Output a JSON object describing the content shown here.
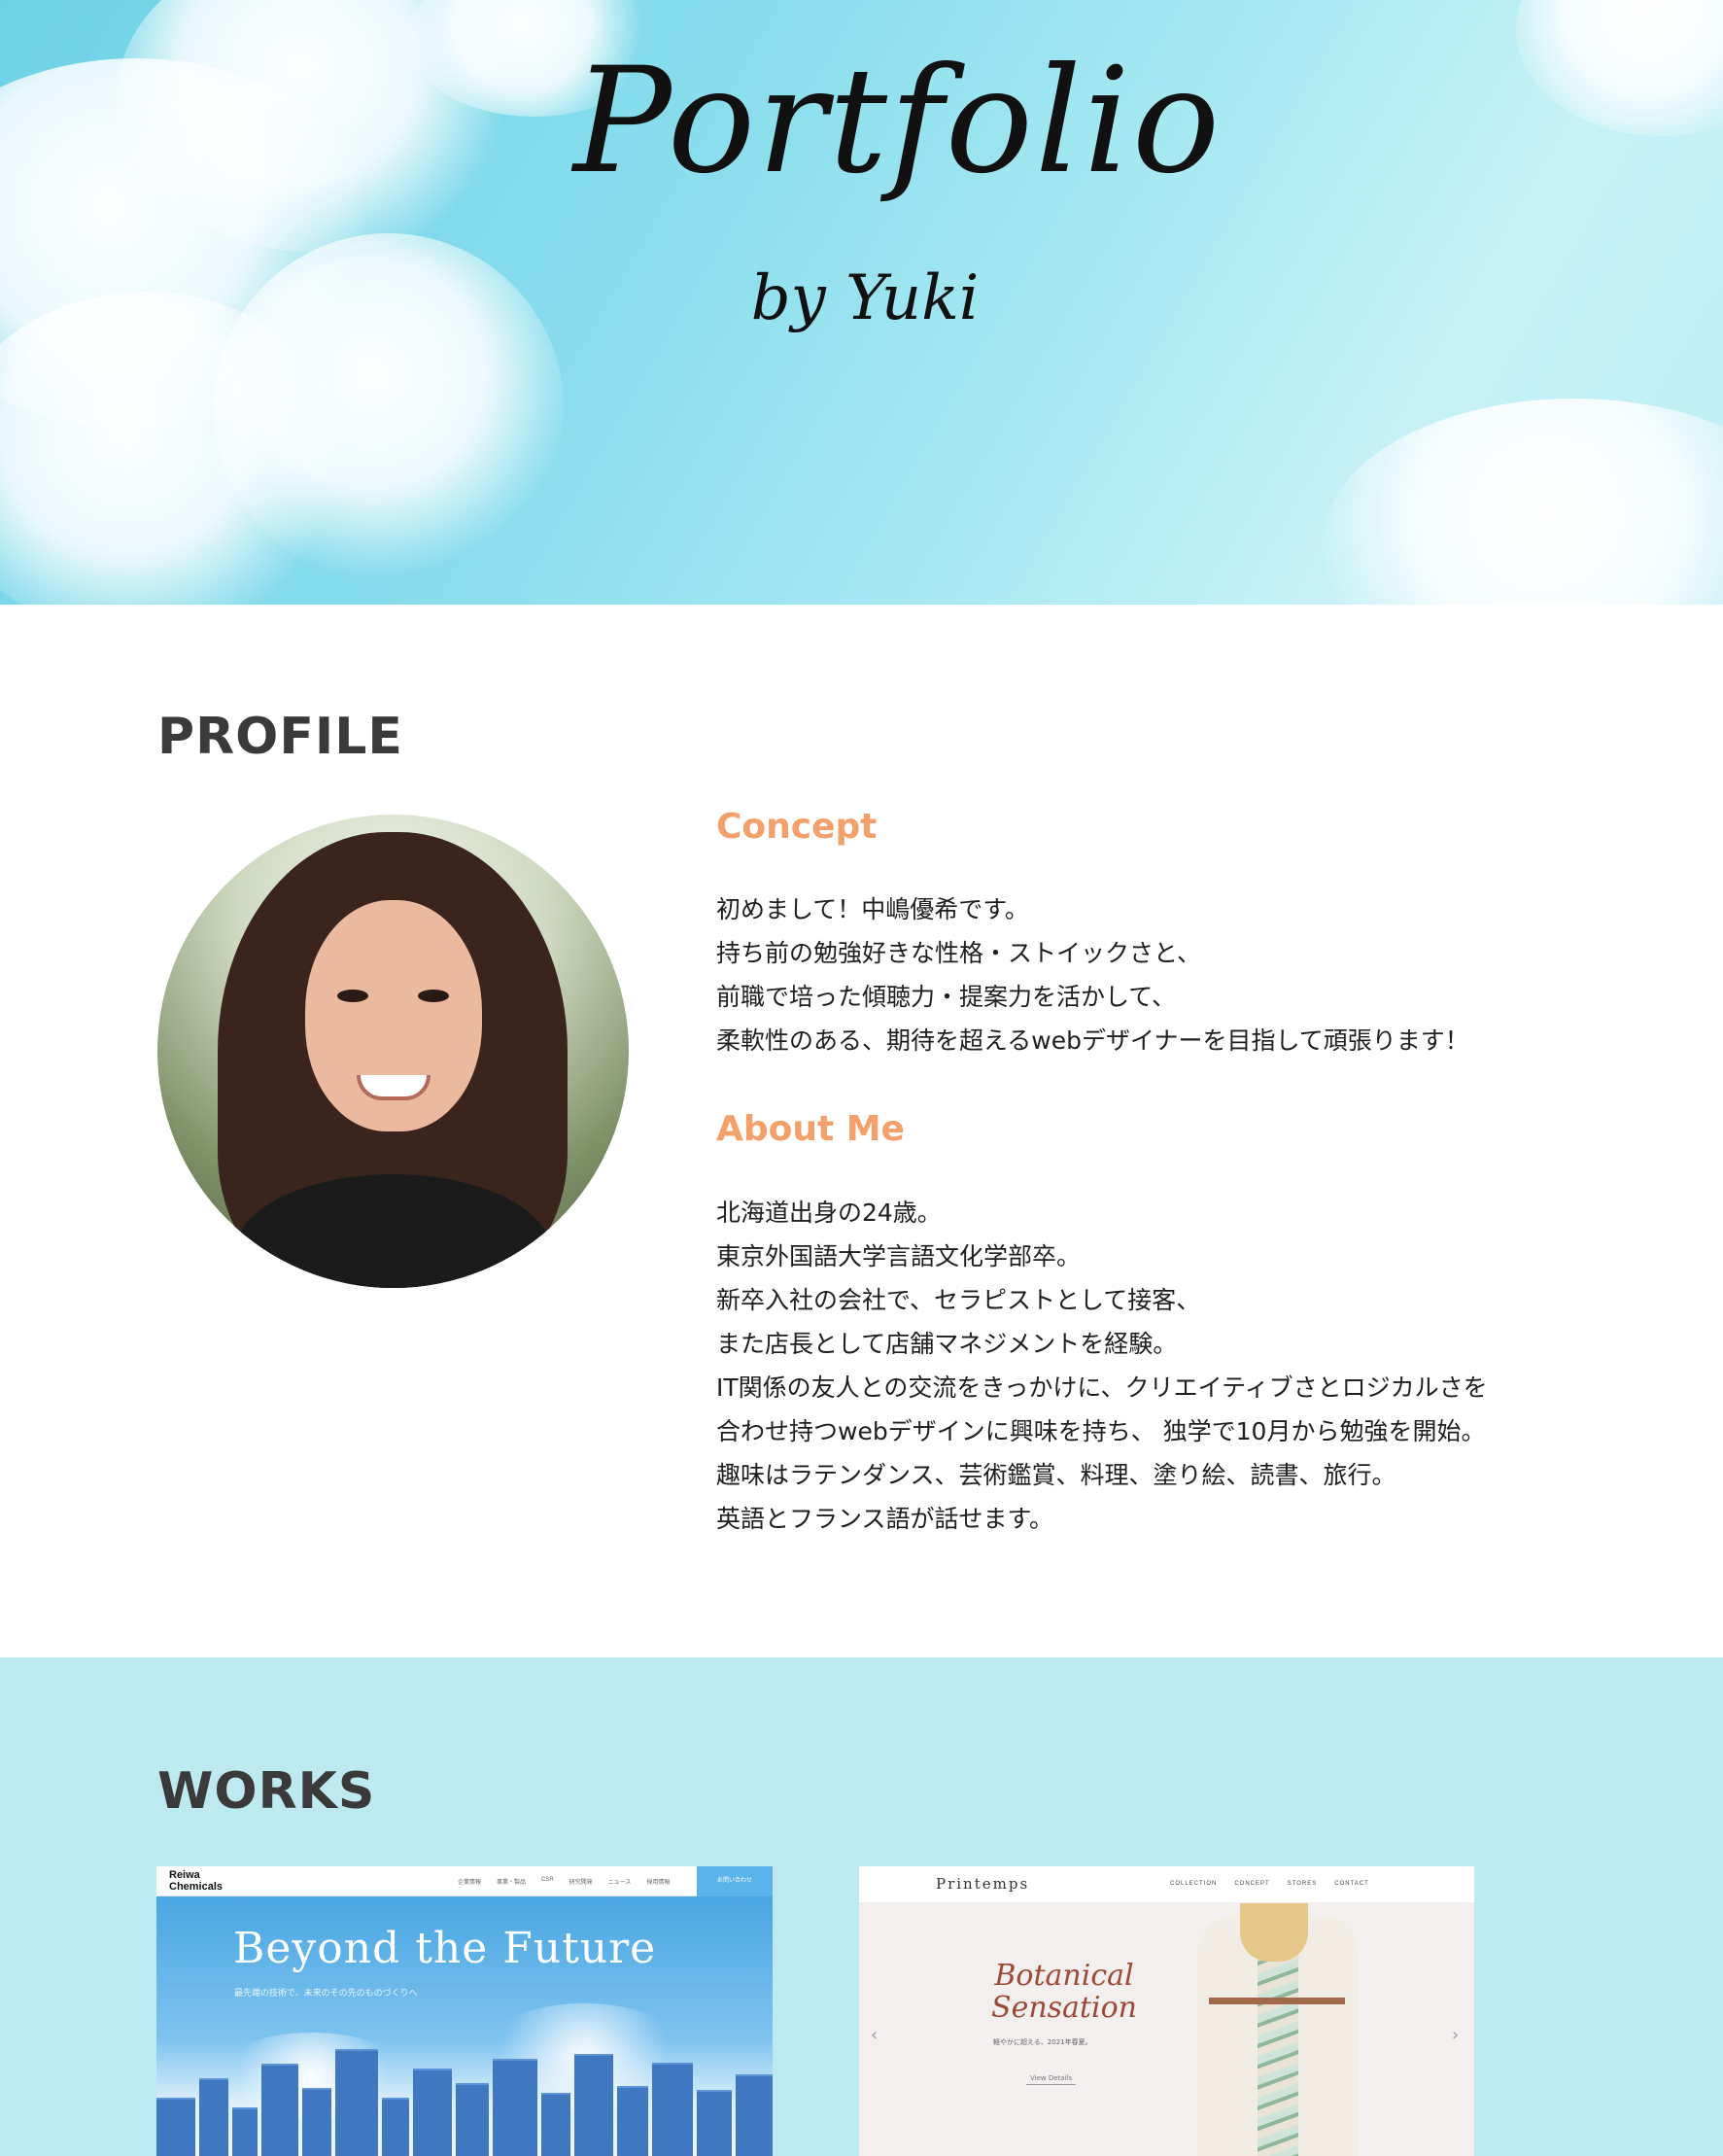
{
  "hero": {
    "title": "Portfolio",
    "subtitle": "by Yuki"
  },
  "profile": {
    "heading": "PROFILE",
    "concept": {
      "label": "Concept",
      "lines": [
        "初めまして！中嶋優希です。",
        "持ち前の勉強好きな性格・ストイックさと、",
        "前職で培った傾聴力・提案力を活かして、",
        "柔軟性のある、期待を超えるwebデザイナーを目指して頑張ります！"
      ]
    },
    "about": {
      "label": "About Me",
      "lines": [
        "北海道出身の24歳。",
        "東京外国語大学言語文化学部卒。",
        "新卒入社の会社で、セラピストとして接客、",
        "また店長として店舗マネジメントを経験。",
        "IT関係の友人との交流をきっかけに、クリエイティブさとロジカルさを",
        "合わせ持つwebデザインに興味を持ち、 独学で10月から勉強を開始。",
        "趣味はラテンダンス、芸術鑑賞、料理、塗り絵、読書、旅行。",
        "英語とフランス語が話せます。"
      ]
    }
  },
  "works": {
    "heading": "WORKS",
    "items": [
      {
        "logo_line1": "Reiwa",
        "logo_line2": "Chemicals",
        "menu": [
          "企業情報",
          "事業・製品",
          "CSR",
          "研究開発",
          "ニュース",
          "採用情報"
        ],
        "contact": "お問い合わせ",
        "title": "Beyond the Future",
        "tagline": "最先端の技術で、未来のその先のものづくりへ"
      },
      {
        "logo": "Printemps",
        "menu": [
          "COLLECTION",
          "CONCEPT",
          "STORES",
          "CONTACT"
        ],
        "script_line1": "Botanical",
        "script_line2": "Sensation",
        "tagline": "軽やかに超える、2021年春夏。",
        "button": "View Details",
        "prev": "‹",
        "next": "›"
      }
    ]
  },
  "colors": {
    "accent": "#f3a06a",
    "works_bg": "#bdeaf0",
    "heading": "#3a3a3a"
  }
}
